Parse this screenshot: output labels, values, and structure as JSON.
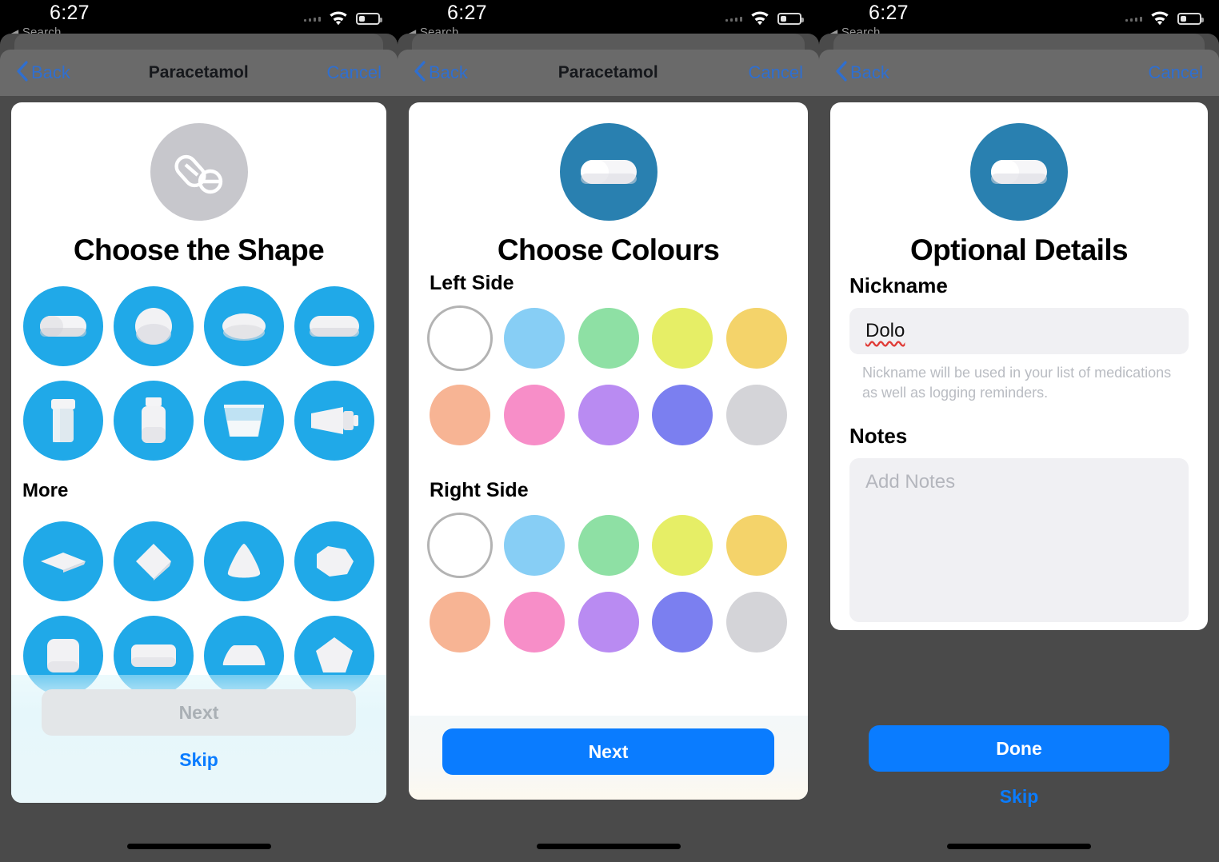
{
  "statusbar": {
    "time": "6:27",
    "back_label": "Search",
    "back_arrow": "◀",
    "wifi_icon": "wifi-icon",
    "battery_icon": "battery-icon",
    "cellular_icon": "cellular-bars-icon"
  },
  "nav": {
    "back_label": "Back",
    "cancel_label": "Cancel",
    "title": "Paracetamol",
    "back_chevron_icon": "chevron-left-icon"
  },
  "panel1": {
    "hero_icon": "pills-icon",
    "hero_circle_color": "#c7c7cc",
    "title": "Choose the Shape",
    "shapes_primary": [
      {
        "name": "capsule",
        "icon": "capsule-shape-icon"
      },
      {
        "name": "round",
        "icon": "round-shape-icon"
      },
      {
        "name": "oval",
        "icon": "oval-shape-icon"
      },
      {
        "name": "oblong",
        "icon": "oblong-shape-icon"
      },
      {
        "name": "vial",
        "icon": "vial-shape-icon"
      },
      {
        "name": "bottle",
        "icon": "bottle-shape-icon"
      },
      {
        "name": "liquid-cup",
        "icon": "liquid-cup-shape-icon"
      },
      {
        "name": "tube",
        "icon": "tube-shape-icon"
      }
    ],
    "more_label": "More",
    "shapes_more": [
      {
        "name": "diamond",
        "icon": "diamond-shape-icon"
      },
      {
        "name": "rhombus",
        "icon": "rhombus-shape-icon"
      },
      {
        "name": "triangle",
        "icon": "triangle-shape-icon"
      },
      {
        "name": "heptagon",
        "icon": "heptagon-shape-icon"
      },
      {
        "name": "square",
        "icon": "square-shape-icon"
      },
      {
        "name": "rectangle",
        "icon": "rectangle-shape-icon"
      },
      {
        "name": "trapezoid",
        "icon": "trapezoid-shape-icon"
      },
      {
        "name": "pentagon",
        "icon": "pentagon-shape-icon"
      }
    ],
    "shape_tile_color": "#20a9e8",
    "next_label": "Next",
    "next_enabled": false,
    "skip_label": "Skip"
  },
  "panel2": {
    "hero_icon": "capsule-icon",
    "hero_circle_color": "#2980b0",
    "title": "Choose Colours",
    "left_side_label": "Left Side",
    "right_side_label": "Right Side",
    "colors": [
      {
        "name": "white",
        "hex": "#ffffff",
        "selected": true
      },
      {
        "name": "light-blue",
        "hex": "#87cef5",
        "selected": false
      },
      {
        "name": "green",
        "hex": "#8ee0a4",
        "selected": false
      },
      {
        "name": "yellow-green",
        "hex": "#e6ee66",
        "selected": false
      },
      {
        "name": "yellow",
        "hex": "#f4d36a",
        "selected": false
      },
      {
        "name": "peach",
        "hex": "#f7b494",
        "selected": false
      },
      {
        "name": "pink",
        "hex": "#f78ec8",
        "selected": false
      },
      {
        "name": "purple",
        "hex": "#b98bf2",
        "selected": false
      },
      {
        "name": "blue-violet",
        "hex": "#7b7ff0",
        "selected": false
      },
      {
        "name": "grey",
        "hex": "#d4d4d8",
        "selected": false
      }
    ],
    "left_selected": "white",
    "right_selected": "white",
    "next_label": "Next",
    "next_enabled": true
  },
  "panel3": {
    "hero_icon": "capsule-icon",
    "hero_circle_color": "#2980b0",
    "title": "Optional Details",
    "nickname_label": "Nickname",
    "nickname_value": "Dolo",
    "nickname_helper": "Nickname will be used in your list of medications as well as logging reminders.",
    "notes_label": "Notes",
    "notes_placeholder": "Add Notes",
    "notes_value": "",
    "done_label": "Done",
    "skip_label": "Skip"
  },
  "accent": {
    "blue": "#0a7cff",
    "nav_blue": "#2f6fd0",
    "tile_blue": "#20a9e8",
    "hero_blue": "#2980b0"
  }
}
